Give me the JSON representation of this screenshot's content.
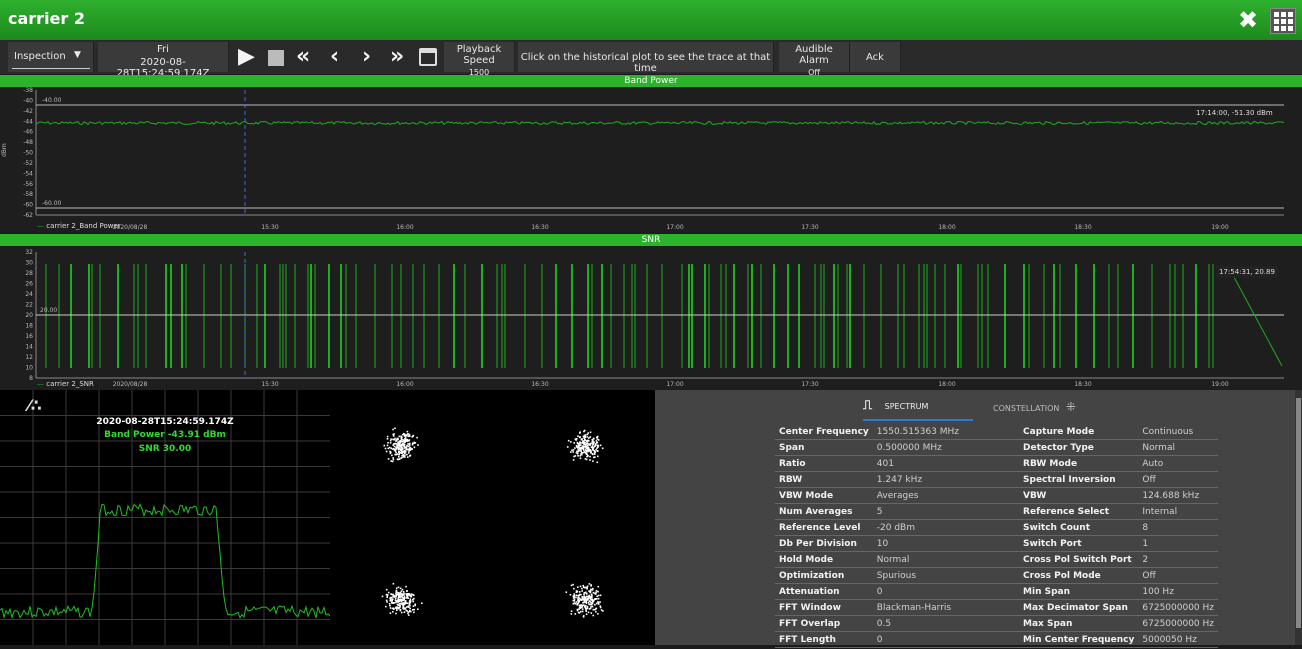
{
  "window": {
    "title": "carrier 2"
  },
  "toolbar": {
    "mode": "Inspection",
    "day": "Fri",
    "datetime": "2020-08-28T15:24:59.174Z",
    "speed_label": "Playback Speed",
    "speed_value": "1500",
    "hint": "Click on the historical plot to see the trace at that time",
    "alarm_label": "Audible Alarm",
    "alarm_value": "Off",
    "ack": "Ack"
  },
  "band_power": {
    "header": "Band Power",
    "yticks": [
      "-38",
      "-40",
      "-42",
      "-44",
      "-46",
      "-48",
      "-50",
      "-52",
      "-54",
      "-56",
      "-58",
      "-60",
      "-62"
    ],
    "ylabel": "dBm",
    "upper_limit": "-40.00",
    "lower_limit": "-60.00",
    "legend": "carrier 2_Band Power",
    "readout": "17:14:00, -51.30 dBm",
    "xticks": [
      "2020/08/28",
      "15:30",
      "16:00",
      "16:30",
      "17:00",
      "17:30",
      "18:00",
      "18:30",
      "19:00"
    ]
  },
  "snr": {
    "header": "SNR",
    "yticks": [
      "32",
      "30",
      "28",
      "26",
      "24",
      "22",
      "20",
      "18",
      "16",
      "14",
      "12",
      "10",
      "8"
    ],
    "limit": "20.00",
    "legend": "carrier 2_SNR",
    "readout": "17:54:31, 20.89",
    "xticks": [
      "2020/08/28",
      "15:30",
      "16:00",
      "16:30",
      "17:00",
      "17:30",
      "18:00",
      "18:30",
      "19:00"
    ]
  },
  "spectrum_view": {
    "timestamp": "2020-08-28T15:24:59.174Z",
    "band_power": "Band Power -43.91 dBm",
    "snr": "SNR 30.00"
  },
  "tabs": {
    "spectrum": "SPECTRUM",
    "constellation": "CONSTELLATION"
  },
  "params": {
    "left": [
      [
        "Center Frequency",
        "1550.515363 MHz"
      ],
      [
        "Span",
        "0.500000 MHz"
      ],
      [
        "Ratio",
        "401"
      ],
      [
        "RBW",
        "1.247 kHz"
      ],
      [
        "VBW Mode",
        "Averages"
      ],
      [
        "Num Averages",
        "5"
      ],
      [
        "Reference Level",
        "-20 dBm"
      ],
      [
        "Db Per Division",
        "10"
      ],
      [
        "Hold Mode",
        "Normal"
      ],
      [
        "Optimization",
        "Spurious"
      ],
      [
        "Attenuation",
        "0"
      ],
      [
        "FFT Window",
        "Blackman-Harris"
      ],
      [
        "FFT Overlap",
        "0.5"
      ],
      [
        "FFT Length",
        "0"
      ]
    ],
    "right": [
      [
        "Capture Mode",
        "Continuous"
      ],
      [
        "Detector Type",
        "Normal"
      ],
      [
        "RBW Mode",
        "Auto"
      ],
      [
        "Spectral Inversion",
        "Off"
      ],
      [
        "VBW",
        "124.688 kHz"
      ],
      [
        "Reference Select",
        "Internal"
      ],
      [
        "Switch Count",
        "8"
      ],
      [
        "Switch Port",
        "1"
      ],
      [
        "Cross Pol Switch Port",
        "2"
      ],
      [
        "Cross Pol Mode",
        "Off"
      ],
      [
        "Min Span",
        "100 Hz"
      ],
      [
        "Max Decimator Span",
        "6725000000 Hz"
      ],
      [
        "Max Span",
        "6725000000 Hz"
      ],
      [
        "Min Center Frequency",
        "5000050 Hz"
      ]
    ]
  },
  "colors": {
    "accent_green": "#2bb32b",
    "trace_green": "#1fae1f",
    "info_bg": "#444444"
  }
}
